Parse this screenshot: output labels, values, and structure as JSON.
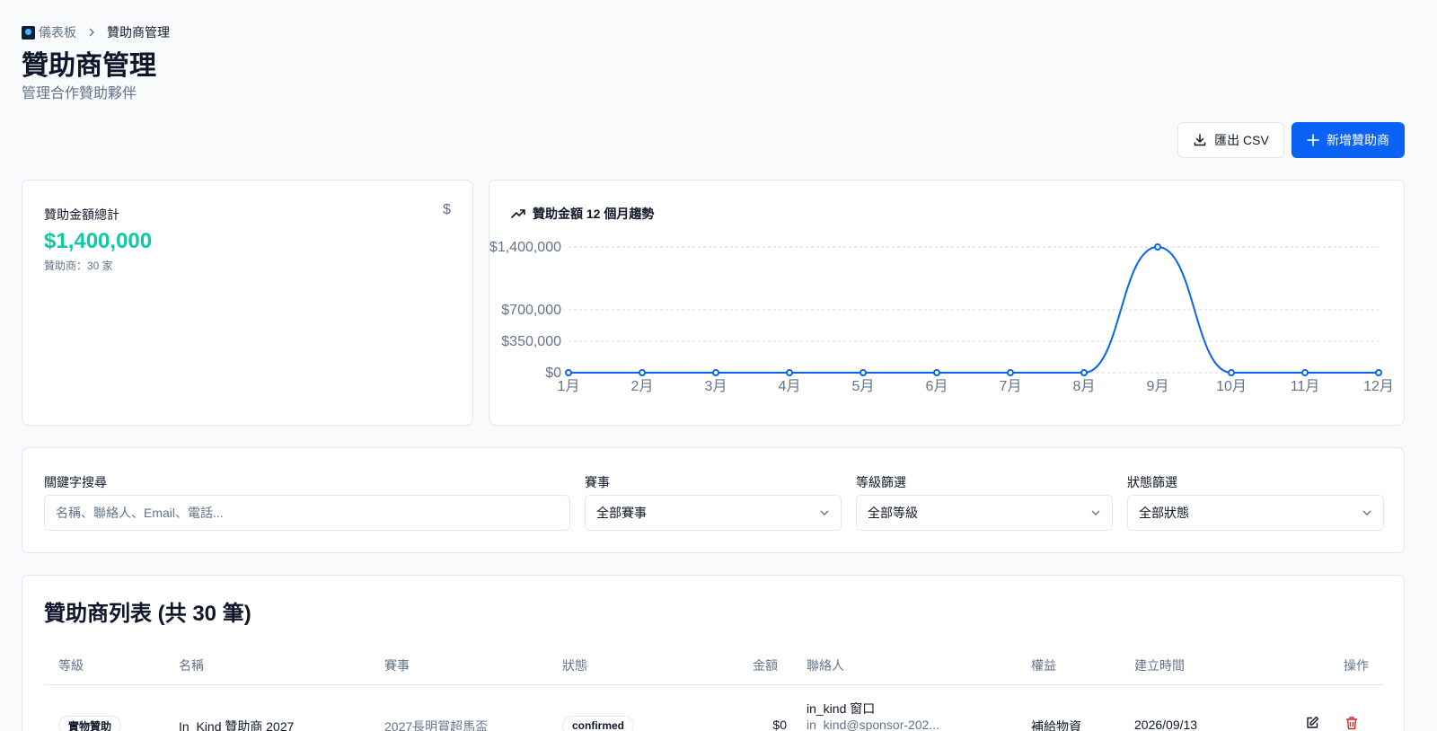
{
  "breadcrumb": {
    "home": "儀表板",
    "current": "贊助商管理"
  },
  "page": {
    "title": "贊助商管理",
    "subtitle": "管理合作贊助夥伴"
  },
  "actions": {
    "export_label": "匯出 CSV",
    "add_label": "新增贊助商"
  },
  "stats": {
    "label": "贊助金額總計",
    "currency_symbol": "$",
    "total": "$1,400,000",
    "sub": "贊助商：30 家"
  },
  "trend": {
    "title": "贊助金額 12 個月趨勢"
  },
  "chart_data": {
    "type": "line",
    "title": "贊助金額 12 個月趨勢",
    "categories": [
      "1月",
      "2月",
      "3月",
      "4月",
      "5月",
      "6月",
      "7月",
      "8月",
      "9月",
      "10月",
      "11月",
      "12月"
    ],
    "series": [
      {
        "values": [
          0,
          0,
          0,
          0,
          0,
          0,
          0,
          0,
          1400000,
          0,
          0,
          0
        ]
      }
    ],
    "y_ticks": [
      0,
      350000,
      700000,
      1400000
    ],
    "y_tick_labels": [
      "$0",
      "$350,000",
      "$700,000",
      "$1,400,000"
    ],
    "ylim": [
      0,
      1400000
    ],
    "grid": true,
    "color": "#0b63f6"
  },
  "filters": {
    "keyword_label": "關鍵字搜尋",
    "keyword_placeholder": "名稱、聯絡人、Email、電話...",
    "event_label": "賽事",
    "event_value": "全部賽事",
    "tier_label": "等級篩選",
    "tier_value": "全部等級",
    "status_label": "狀態篩選",
    "status_value": "全部狀態"
  },
  "table": {
    "title": "贊助商列表 (共 30 筆)",
    "columns": [
      "等級",
      "名稱",
      "賽事",
      "狀態",
      "金額",
      "聯絡人",
      "權益",
      "建立時間",
      "操作"
    ],
    "rows": [
      {
        "tier": "實物贊助",
        "name": "In_Kind 贊助商 2027",
        "event": "2027長明賞超馬盃",
        "status": "confirmed",
        "amount": "$0",
        "contact_name": "in_kind 窗口",
        "contact_email": "in_kind@sponsor-202...",
        "benefits": "補給物資",
        "created": "2026/09/13"
      }
    ]
  }
}
